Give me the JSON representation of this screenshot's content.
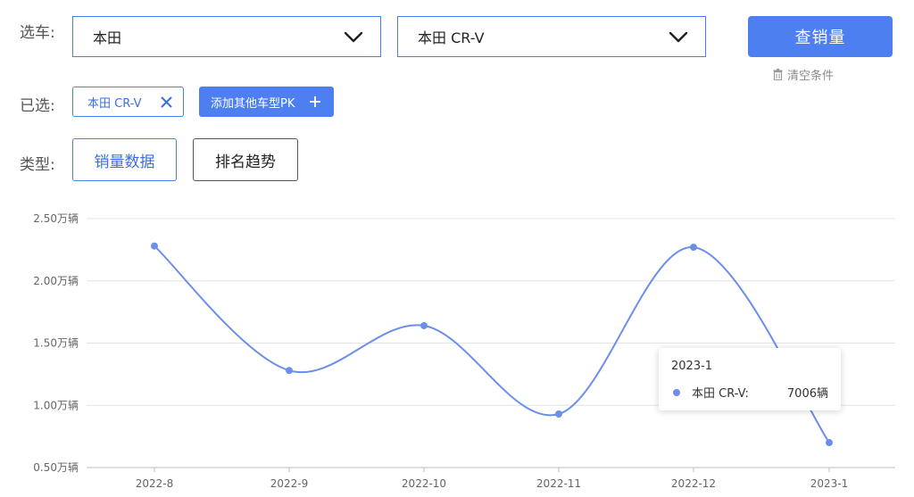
{
  "filters": {
    "select_car_label": "选车:",
    "brand_select": {
      "value": "本田"
    },
    "model_select": {
      "value": "本田 CR-V"
    },
    "query_button": "查销量",
    "clear_link": "清空条件"
  },
  "selected": {
    "label": "已选:",
    "chips": [
      {
        "label": "本田 CR-V"
      }
    ],
    "add_pk_button": "添加其他车型PK"
  },
  "type": {
    "label": "类型:",
    "options": [
      {
        "label": "销量数据",
        "active": true
      },
      {
        "label": "排名趋势",
        "active": false
      }
    ]
  },
  "colors": {
    "accent": "#4e7ff0",
    "line": "#6b8fe8",
    "grid": "#e3e3e3"
  },
  "chart_data": {
    "type": "line",
    "categories": [
      "2022-8",
      "2022-9",
      "2022-10",
      "2022-11",
      "2022-12",
      "2023-1"
    ],
    "series": [
      {
        "name": "本田 CR-V",
        "values": [
          2.28,
          1.28,
          1.64,
          0.93,
          2.27,
          0.7006
        ]
      }
    ],
    "ylim": [
      0.5,
      2.5
    ],
    "yticks": [
      "0.50万辆",
      "1.00万辆",
      "1.50万辆",
      "2.00万辆",
      "2.50万辆"
    ],
    "ytick_values": [
      0.5,
      1.0,
      1.5,
      2.0,
      2.5
    ],
    "grid": true,
    "smooth": true
  },
  "tooltip": {
    "title": "2023-1",
    "series_name": "本田 CR-V:",
    "value": "7006辆"
  }
}
